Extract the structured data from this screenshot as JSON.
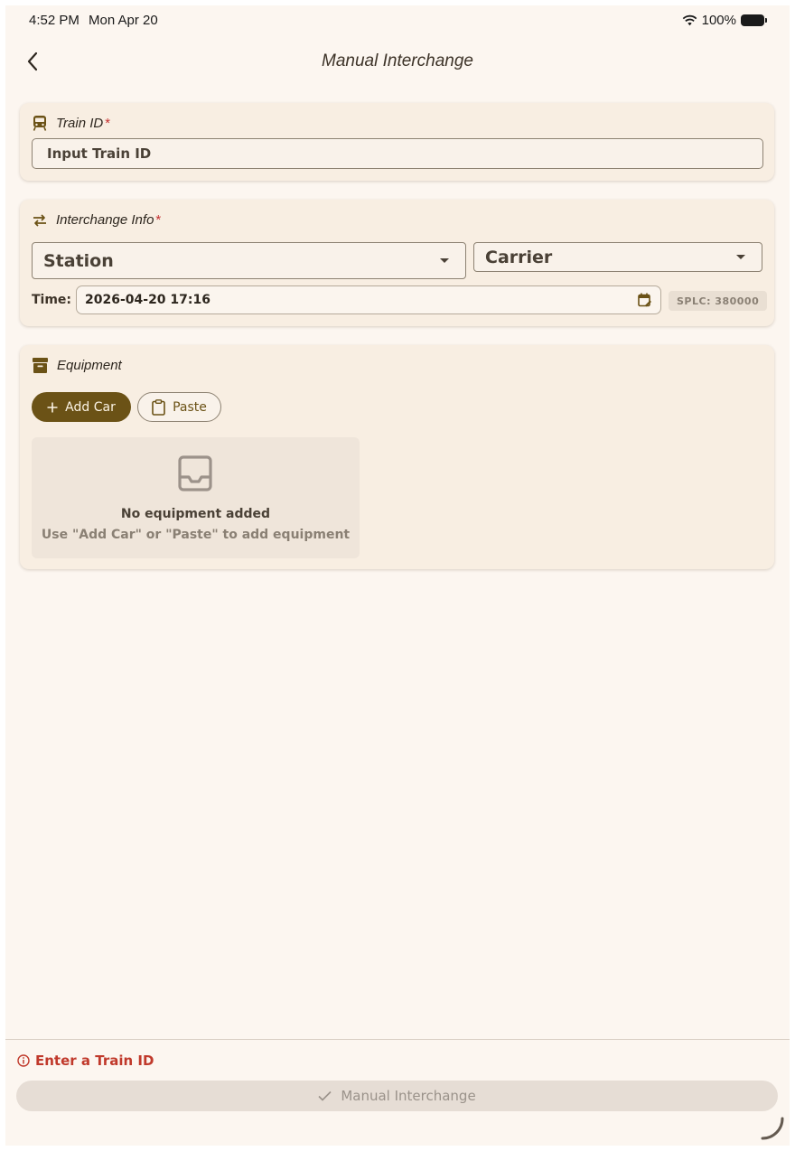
{
  "status_bar": {
    "time": "4:52 PM",
    "date": "Mon Apr 20",
    "battery": "100%"
  },
  "nav": {
    "back_icon": "chevron-left-icon",
    "title": "Manual Interchange"
  },
  "train_card": {
    "icon": "train-icon",
    "title": "Train ID",
    "required_mark": "*",
    "input_placeholder": "Input Train ID",
    "input_value": ""
  },
  "interchange_card": {
    "icon": "swap-arrows-icon",
    "title": "Interchange Info",
    "required_mark": "*",
    "station_label": "Station",
    "carrier_label": "Carrier",
    "time_label": "Time:",
    "time_value": "2026-04-20  17:16",
    "calendar_icon": "calendar-edit-icon",
    "splc": "SPLC: 380000"
  },
  "equipment_card": {
    "icon": "archive-box-icon",
    "title": "Equipment",
    "add_car_label": "Add Car",
    "paste_label": "Paste",
    "empty_title": "No equipment added",
    "empty_subtitle": "Use \"Add Car\" or \"Paste\" to add equipment"
  },
  "footer": {
    "error_icon": "info-circle-icon",
    "error_message": "Enter a Train ID",
    "submit_label": "Manual Interchange",
    "submit_icon": "checkmark-icon"
  },
  "colors": {
    "background": "#fcf6f0",
    "card": "#f8eee2",
    "accent": "#6b5216",
    "error": "#c0392b",
    "required": "#c53030"
  }
}
